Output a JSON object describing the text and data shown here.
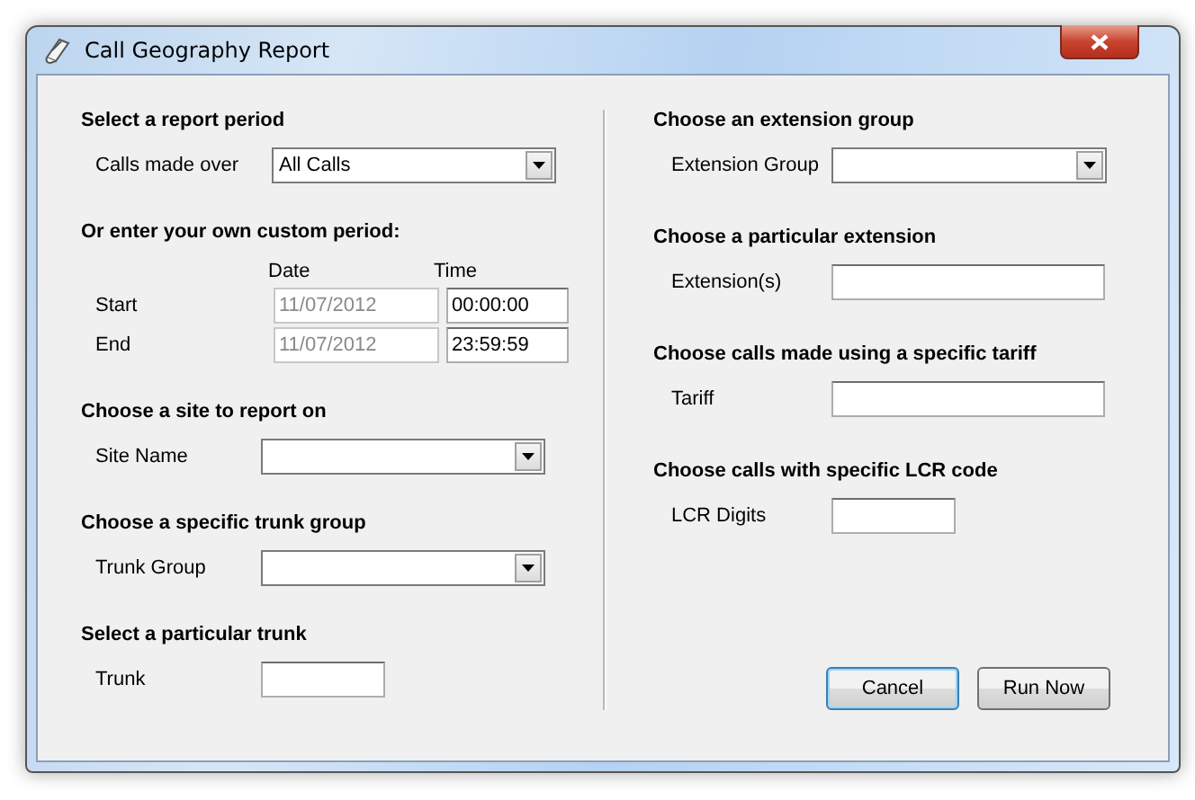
{
  "window": {
    "title": "Call Geography Report"
  },
  "left_sections": [
    {
      "heading": "Select a report period",
      "rows": [
        {
          "kind": "dropdown",
          "label": "Calls made over",
          "value": "All Calls"
        }
      ]
    },
    {
      "heading": "Or enter your own custom period:",
      "rows": [
        {
          "kind": "header",
          "labels": [
            "Date",
            "Time"
          ]
        },
        {
          "kind": "datetime",
          "label": "Start",
          "date": {
            "value": "11/07/2012",
            "disabled": true
          },
          "time": {
            "value": "00:00:00",
            "disabled": false
          }
        },
        {
          "kind": "datetime",
          "label": "End",
          "date": {
            "value": "11/07/2012",
            "disabled": true
          },
          "time": {
            "value": "23:59:59",
            "disabled": false
          }
        }
      ]
    },
    {
      "heading": "Choose a site to report on",
      "rows": [
        {
          "kind": "dropdown",
          "label": "Site Name"
        }
      ]
    },
    {
      "heading": "Choose a specific trunk group",
      "rows": [
        {
          "kind": "dropdown",
          "label": "Trunk Group"
        }
      ]
    },
    {
      "heading": "Select a particular trunk",
      "rows": [
        {
          "kind": "short_text",
          "label": "Trunk"
        }
      ]
    }
  ],
  "right_sections": [
    {
      "heading": "Choose an extension group",
      "rows": [
        {
          "kind": "dropdown",
          "label": "Extension Group"
        }
      ]
    },
    {
      "heading": "Choose a particular extension",
      "rows": [
        {
          "kind": "text",
          "label": "Extension(s)"
        }
      ]
    },
    {
      "heading": "Choose calls made using a specific tariff",
      "rows": [
        {
          "kind": "text",
          "label": "Tariff"
        }
      ]
    },
    {
      "heading": "Choose calls with specific LCR code",
      "rows": [
        {
          "kind": "short_text",
          "label": "LCR Digits"
        }
      ]
    }
  ],
  "buttons": [
    {
      "label": "Cancel",
      "default": true
    },
    {
      "label": "Run Now",
      "default": false
    }
  ]
}
